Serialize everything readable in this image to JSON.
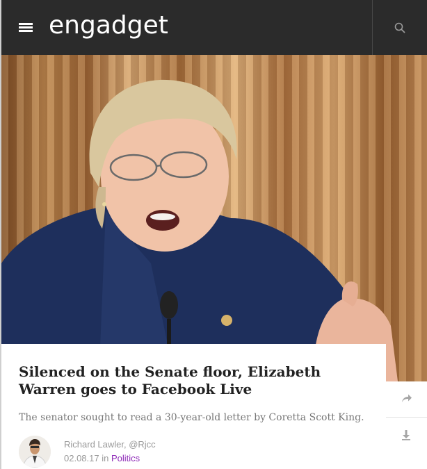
{
  "header": {
    "logo_text": "engadget",
    "menu_icon": "hamburger-menu-icon",
    "search_icon": "search-icon",
    "background": "#2b2b2b"
  },
  "hero": {
    "description_icon": "hero-photo"
  },
  "article": {
    "headline": "Silenced on the Senate floor, Elizabeth Warren goes to Facebook Live",
    "dek": "The senator sought to read a 30-year-old letter by Coretta Scott King.",
    "author": "Richard Lawler, @Rjcc",
    "date": "02.08.17",
    "in_word": "in",
    "category": "Politics",
    "category_color": "#8f2bb8"
  },
  "actions": {
    "share_icon": "share-arrow-icon",
    "save_icon": "download-icon"
  }
}
